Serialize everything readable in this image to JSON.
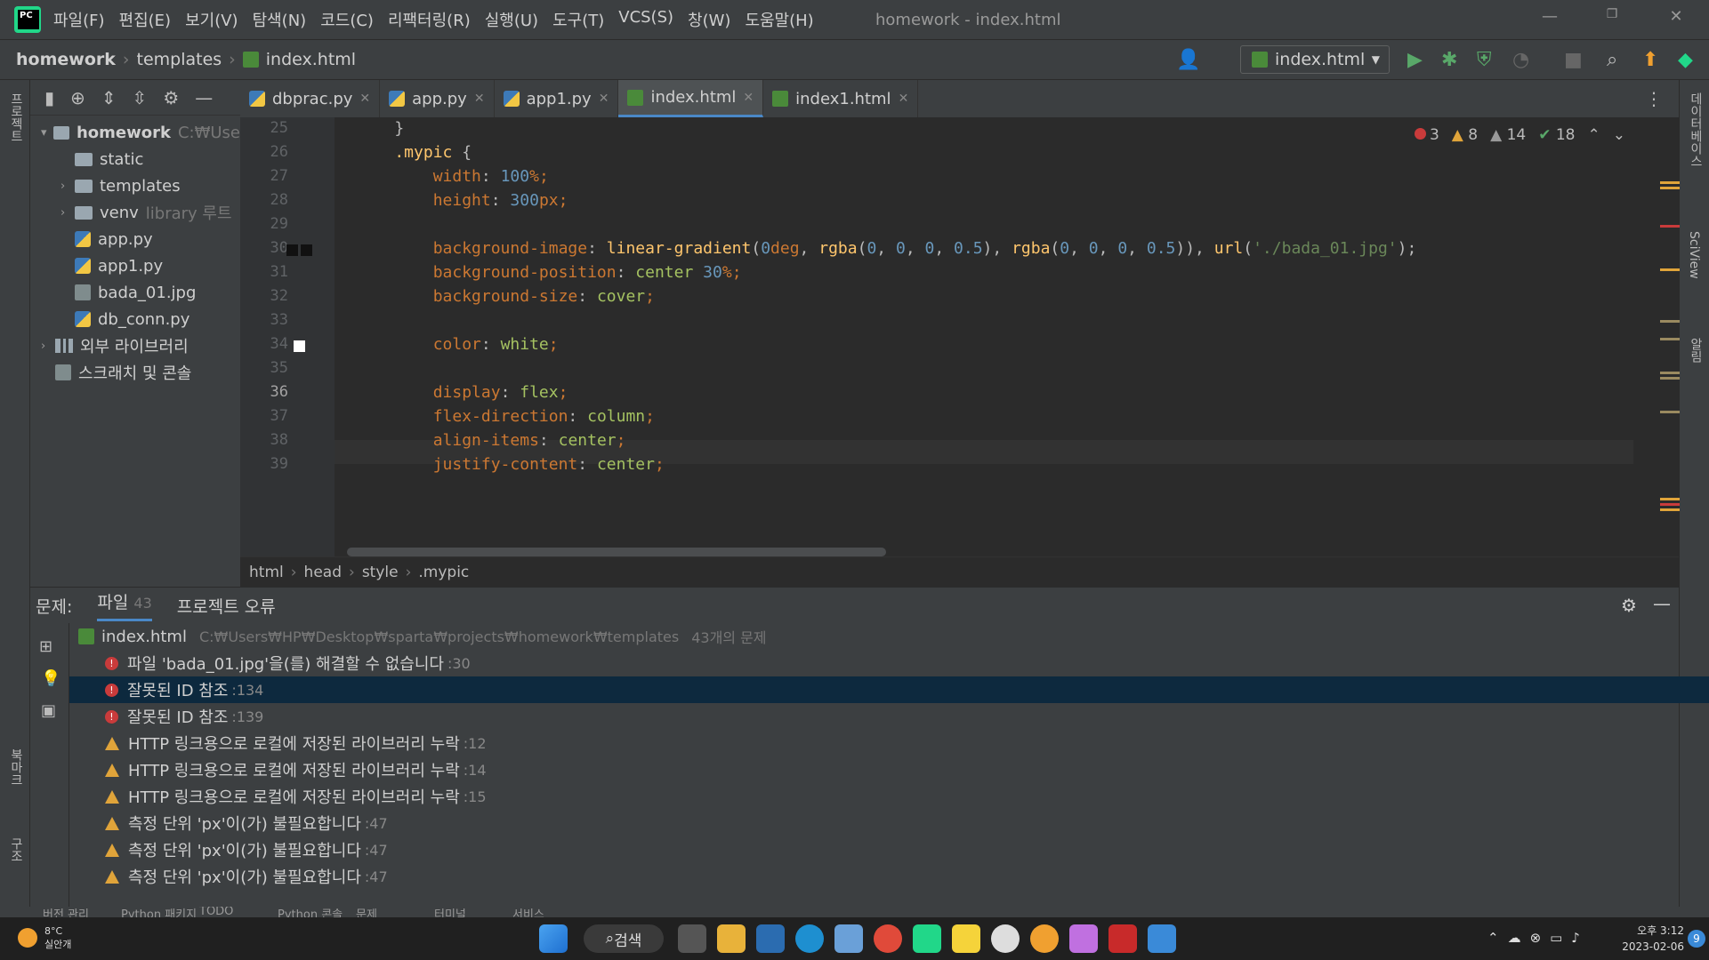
{
  "window": {
    "title": "homework - index.html"
  },
  "menu": [
    "파일(F)",
    "편집(E)",
    "보기(V)",
    "탐색(N)",
    "코드(C)",
    "리팩터링(R)",
    "실행(U)",
    "도구(T)",
    "VCS(S)",
    "창(W)",
    "도움말(H)"
  ],
  "navbar": {
    "crumbs": [
      "homework",
      "templates",
      "index.html"
    ],
    "run_config": "index.html"
  },
  "left_tool": {
    "project_label": "프로젝트",
    "bookmarks_label": "북마크",
    "structure_label": "구조"
  },
  "right_tool": {
    "database_label": "데이터베이스",
    "sciview_label": "SciView",
    "notifications_label": "알림"
  },
  "project_tree": [
    {
      "name": "homework",
      "extra": "C:₩Use",
      "type": "folder",
      "indent": 0,
      "arrow": "▾",
      "bold": true
    },
    {
      "name": "static",
      "extra": "",
      "type": "folder",
      "indent": 1,
      "arrow": ""
    },
    {
      "name": "templates",
      "extra": "",
      "type": "folder",
      "indent": 1,
      "arrow": "›"
    },
    {
      "name": "venv",
      "extra": "library 루트",
      "type": "folder",
      "indent": 1,
      "arrow": "›"
    },
    {
      "name": "app.py",
      "extra": "",
      "type": "py",
      "indent": 1,
      "arrow": ""
    },
    {
      "name": "app1.py",
      "extra": "",
      "type": "py",
      "indent": 1,
      "arrow": ""
    },
    {
      "name": "bada_01.jpg",
      "extra": "",
      "type": "img",
      "indent": 1,
      "arrow": ""
    },
    {
      "name": "db_conn.py",
      "extra": "",
      "type": "py",
      "indent": 1,
      "arrow": ""
    },
    {
      "name": "외부 라이브러리",
      "extra": "",
      "type": "lib",
      "indent": 0,
      "arrow": "›"
    },
    {
      "name": "스크래치 및 콘솔",
      "extra": "",
      "type": "scratch",
      "indent": 0,
      "arrow": ""
    }
  ],
  "tabs": [
    {
      "label": "dbprac.py",
      "type": "py",
      "active": false
    },
    {
      "label": "app.py",
      "type": "py",
      "active": false
    },
    {
      "label": "app1.py",
      "type": "py",
      "active": false
    },
    {
      "label": "index.html",
      "type": "html",
      "active": true
    },
    {
      "label": "index1.html",
      "type": "html",
      "active": false
    }
  ],
  "inspections": {
    "errors": "3",
    "warnings": "8",
    "weak_warnings": "14",
    "ok": "18"
  },
  "code_lines": [
    {
      "n": "25",
      "html": "<span class='p'>    }</span>"
    },
    {
      "n": "26",
      "html": "<span class='sel'>    .mypic</span> <span class='p'>{</span>"
    },
    {
      "n": "27",
      "html": "        <span class='k'>width</span><span class='p'>: </span><span class='n'>100</span><span class='k'>%</span><span class='k'>;</span>"
    },
    {
      "n": "28",
      "html": "        <span class='k'>height</span><span class='p'>: </span><span class='n'>300</span><span class='k'>px;</span>"
    },
    {
      "n": "29",
      "html": ""
    },
    {
      "n": "30",
      "html": "        <span class='k'>background-image</span><span class='p'>: </span><span class='f'>linear-gradient</span><span class='p'>(</span><span class='n'>0</span><span class='k'>deg</span><span class='p'>, </span><span class='f'>rgba</span><span class='p'>(</span><span class='n'>0</span><span class='p'>, </span><span class='n'>0</span><span class='p'>, </span><span class='n'>0</span><span class='p'>, </span><span class='n'>0.5</span><span class='p'>), </span><span class='f'>rgba</span><span class='p'>(</span><span class='n'>0</span><span class='p'>, </span><span class='n'>0</span><span class='p'>, </span><span class='n'>0</span><span class='p'>, </span><span class='n'>0.5</span><span class='p'>)), </span><span class='f'>url</span><span class='p'>(</span><span class='s'>'./bada_01.jpg'</span><span class='p'>);</span>"
    },
    {
      "n": "31",
      "html": "        <span class='k'>background-position</span><span class='p'>: </span><span class='v'>center</span> <span class='n'>30</span><span class='k'>%;</span>"
    },
    {
      "n": "32",
      "html": "        <span class='k'>background-size</span><span class='p'>: </span><span class='v'>cover</span><span class='k'>;</span>"
    },
    {
      "n": "33",
      "html": ""
    },
    {
      "n": "34",
      "html": "        <span class='k'>color</span><span class='p'>: </span><span class='v'>white</span><span class='k'>;</span>"
    },
    {
      "n": "35",
      "html": ""
    },
    {
      "n": "36",
      "html": "        <span class='k'>display</span><span class='p'>: </span><span class='v'>flex</span><span class='k'>;</span>"
    },
    {
      "n": "37",
      "html": "        <span class='k'>flex-direction</span><span class='p'>: </span><span class='v'>column</span><span class='k'>;</span>"
    },
    {
      "n": "38",
      "html": "        <span class='k'>align-items</span><span class='p'>: </span><span class='v'>center</span><span class='k'>;</span>"
    },
    {
      "n": "39",
      "html": "        <span class='k'>justify-content</span><span class='p'>: </span><span class='v'>center</span><span class='k'>;</span>"
    }
  ],
  "editor_breadcrumb": [
    "html",
    "head",
    "style",
    ".mypic"
  ],
  "problems": {
    "label": "문제:",
    "tab_file": "파일",
    "tab_file_count": "43",
    "tab_project": "프로젝트 오류",
    "file_name": "index.html",
    "file_path": "C:₩Users₩HP₩Desktop₩sparta₩projects₩homework₩templates",
    "file_count": "43개의 문제",
    "rows": [
      {
        "sev": "error",
        "text": "파일 'bada_01.jpg'을(를) 해결할 수 없습니다",
        "line": ":30",
        "selected": false
      },
      {
        "sev": "error",
        "text": "잘못된 ID 참조",
        "line": ":134",
        "selected": true
      },
      {
        "sev": "error",
        "text": "잘못된 ID 참조",
        "line": ":139",
        "selected": false
      },
      {
        "sev": "warn",
        "text": "HTTP 링크용으로 로컬에 저장된 라이브러리 누락",
        "line": ":12",
        "selected": false
      },
      {
        "sev": "warn",
        "text": "HTTP 링크용으로 로컬에 저장된 라이브러리 누락",
        "line": ":14",
        "selected": false
      },
      {
        "sev": "warn",
        "text": "HTTP 링크용으로 로컬에 저장된 라이브러리 누락",
        "line": ":15",
        "selected": false
      },
      {
        "sev": "warn",
        "text": "측정 단위 'px'이(가) 불필요합니다",
        "line": ":47",
        "selected": false
      },
      {
        "sev": "warn",
        "text": "측정 단위 'px'이(가) 불필요합니다",
        "line": ":47",
        "selected": false
      },
      {
        "sev": "warn",
        "text": "측정 단위 'px'이(가) 불필요합니다",
        "line": ":47",
        "selected": false
      }
    ]
  },
  "statusbar_tabs": [
    "버전 관리",
    "Python 패키지",
    "TODO",
    "Python 콘솔",
    "문제",
    "터미널",
    "서비스"
  ],
  "taskbar": {
    "search": "검색",
    "weather_temp": "8°C",
    "weather_desc": "실안개",
    "time": "오후 3:12",
    "date": "2023-02-06",
    "notif_count": "9"
  }
}
